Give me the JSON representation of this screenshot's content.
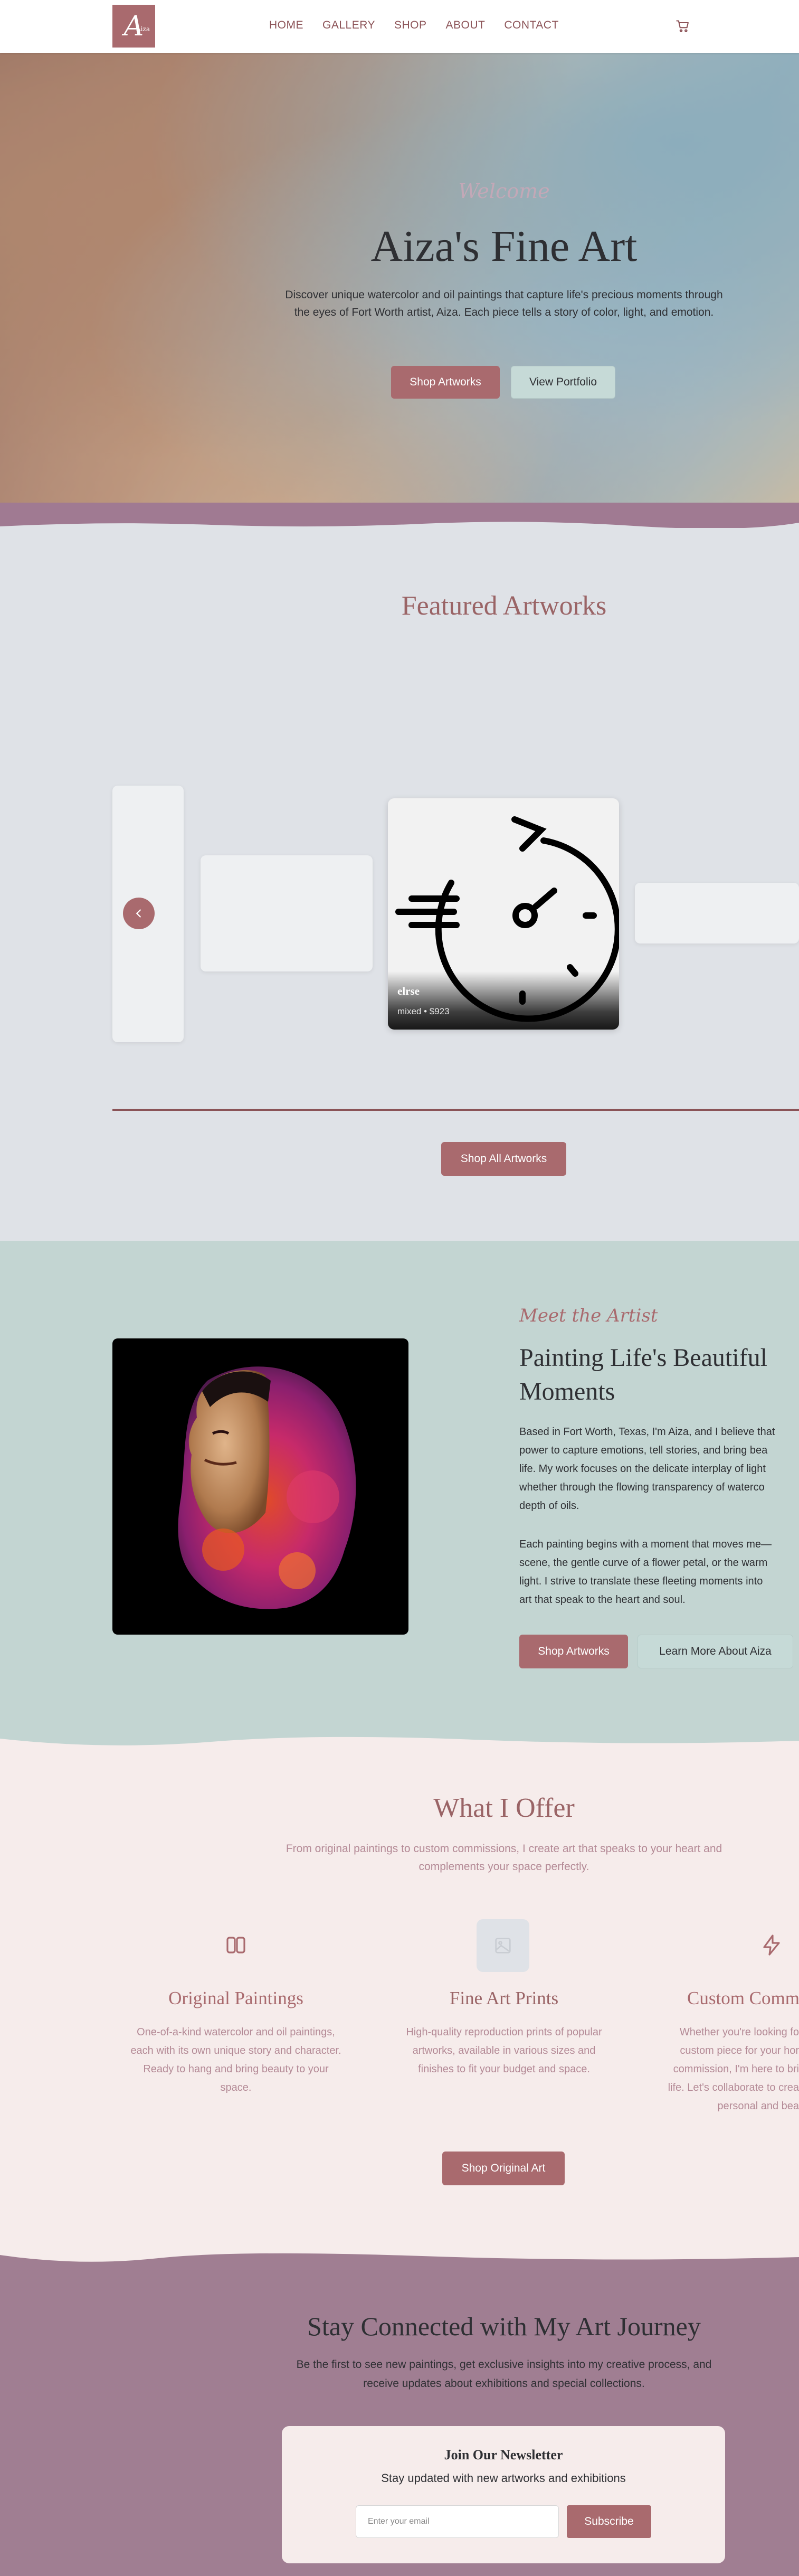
{
  "nav": {
    "logo_text": "A",
    "logo_sub": "Aiza",
    "links": [
      "HOME",
      "GALLERY",
      "SHOP",
      "ABOUT",
      "CONTACT"
    ],
    "cart_icon": "cart-icon"
  },
  "hero": {
    "welcome": "Welcome",
    "title": "Aiza's Fine Art",
    "description": "Discover unique watercolor and oil paintings that capture life's precious moments through the eyes of Fort Worth artist, Aiza. Each piece tells a story of color, light, and emotion.",
    "primary_btn": "Shop Artworks",
    "secondary_btn": "View Portfolio"
  },
  "featured": {
    "title": "Featured Artworks",
    "card": {
      "name": "elrse",
      "meta": "mixed • $923"
    },
    "prev_icon": "chevron-left-icon",
    "shop_all_btn": "Shop All Artworks"
  },
  "meet": {
    "kicker": "Meet the Artist",
    "title": "Painting Life's Beautiful Moments",
    "p1_lines": [
      "Based in Fort Worth, Texas, I'm Aiza, and I believe that",
      "power to capture emotions, tell stories, and bring bea",
      "life. My work focuses on the delicate interplay of light",
      "whether through the flowing transparency of waterco",
      "depth of oils."
    ],
    "p2_lines": [
      "Each painting begins with a moment that moves me—",
      "scene, the gentle curve of a flower petal, or the warm",
      "light. I strive to translate these fleeting moments into",
      "art that speak to the heart and soul."
    ],
    "primary_btn": "Shop Artworks",
    "secondary_btn": "Learn More About Aiza"
  },
  "offer": {
    "title": "What I Offer",
    "subtitle": "From original paintings to custom commissions, I create art that speaks to your heart and complements your space perfectly.",
    "services": [
      {
        "icon": "book-open-icon",
        "title": "Original Paintings",
        "desc_lines": [
          "One-of-a-kind watercolor and oil paintings,",
          "each with its own unique story and character.",
          "Ready to hang and bring beauty to your",
          "space."
        ]
      },
      {
        "icon": "image-icon",
        "title": "Fine Art Prints",
        "desc_lines": [
          "High-quality reproduction prints of popular",
          "artworks, available in various sizes and",
          "finishes to fit your budget and space."
        ]
      },
      {
        "icon": "zap-icon",
        "title": "Custom Comm",
        "desc_lines": [
          "Whether you're looking fo",
          "custom piece for your hor",
          "commission, I'm here to bri",
          "life. Let's collaborate to crea",
          "personal and bea"
        ]
      }
    ],
    "shop_btn": "Shop Original Art"
  },
  "newsletter": {
    "title": "Stay Connected with My Art Journey",
    "subtitle": "Be the first to see new paintings, get exclusive insights into my creative process, and receive updates about exhibitions and special collections.",
    "box_title": "Join Our Newsletter",
    "box_subtitle": "Stay updated with new artworks and exhibitions",
    "email_placeholder": "Enter your email",
    "subscribe_btn": "Subscribe"
  },
  "colors": {
    "rose": "#a96a6e",
    "mint": "#c3d5d2",
    "mauve": "#a07a92",
    "blush": "#f6eceb",
    "slate": "#dfe2e7"
  }
}
